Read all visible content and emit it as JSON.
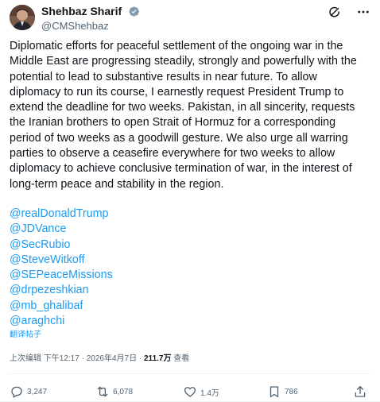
{
  "author": {
    "display_name": "Shehbaz Sharif",
    "handle": "@CMShehbaz",
    "verified": true
  },
  "tweet": {
    "text": "Diplomatic efforts for peaceful settlement of the ongoing war in the Middle East are progressing steadily, strongly and powerfully with the potential to lead to substantive results in near future. To allow diplomacy to run its course, I earnestly request President Trump to extend the deadline for two weeks. Pakistan, in all sincerity, requests the Iranian brothers to open Strait of Hormuz for a corresponding period of two weeks as a goodwill gesture. We also urge all warring parties to observe a ceasefire everywhere for two weeks to allow diplomacy to achieve conclusive termination of war, in the interest of long-term peace and stability in the region.",
    "mentions": [
      "@realDonaldTrump",
      "@JDVance",
      "@SecRubio",
      "@SteveWitkoff",
      "@SEPeaceMissions",
      "@drpezeshkian",
      "@mb_ghalibaf",
      "@araghchi"
    ],
    "translate_label": "翻译帖子"
  },
  "meta": {
    "edited": "上次编辑",
    "time": "下午12:17",
    "separator": "·",
    "date": "2026年4月7日",
    "views_count": "211.7万",
    "views_label": "查看"
  },
  "actions": {
    "replies": "3,247",
    "reposts": "6,078",
    "likes": "1.4万",
    "bookmarks": "786"
  },
  "icons": {
    "verified": "verified-badge-icon",
    "grok": "grok-icon",
    "more": "more-icon",
    "reply": "reply-icon",
    "repost": "repost-icon",
    "like": "heart-icon",
    "bookmark": "bookmark-icon",
    "share": "share-icon"
  },
  "colors": {
    "link": "#1d9bf0",
    "text": "#0f1419",
    "secondary": "#536471"
  }
}
